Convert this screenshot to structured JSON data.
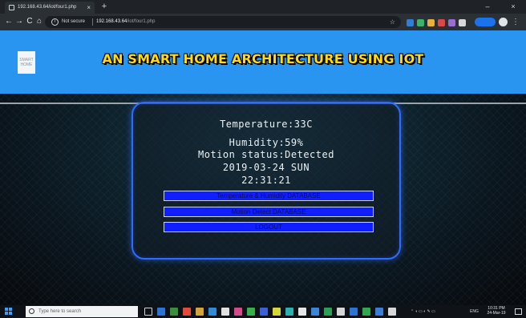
{
  "browser": {
    "tab_title": "192.168.43.64/iot/four1.php",
    "tab_close": "×",
    "new_tab": "+",
    "window_controls": {
      "minimize": "–",
      "close": "×"
    },
    "nav": {
      "back": "←",
      "forward": "→",
      "reload": "C",
      "home": "⌂"
    },
    "not_secure_label": "Not secure",
    "url_host": "192.168.43.64",
    "url_path": "/iot/four1.php",
    "bookmark_star": "☆",
    "menu": "⋮"
  },
  "page": {
    "logo_text": "SMART HOME",
    "title": "AN SMART HOME ARCHITECTURE USING IOT",
    "readings": {
      "temperature": "Temperature:33C",
      "humidity": "Humidity:59%",
      "motion": "Motion status:Detected",
      "date": "2019-03-24 SUN",
      "time": "22:31:21"
    },
    "buttons": {
      "temp_humidity_db": "Temperature & Humidity DATABASE",
      "motion_db": "Motion Detect DATABASE",
      "logout": "LOGOUT"
    },
    "colors": {
      "header": "#2995f0",
      "title": "#ffd91a",
      "panel_border": "#2f6bff",
      "button": "#0f1fff"
    }
  },
  "taskbar": {
    "search_placeholder": "Type here to search",
    "lang": "ENG",
    "clock_time": "10:31 PM",
    "clock_date": "24-Mar-19"
  }
}
